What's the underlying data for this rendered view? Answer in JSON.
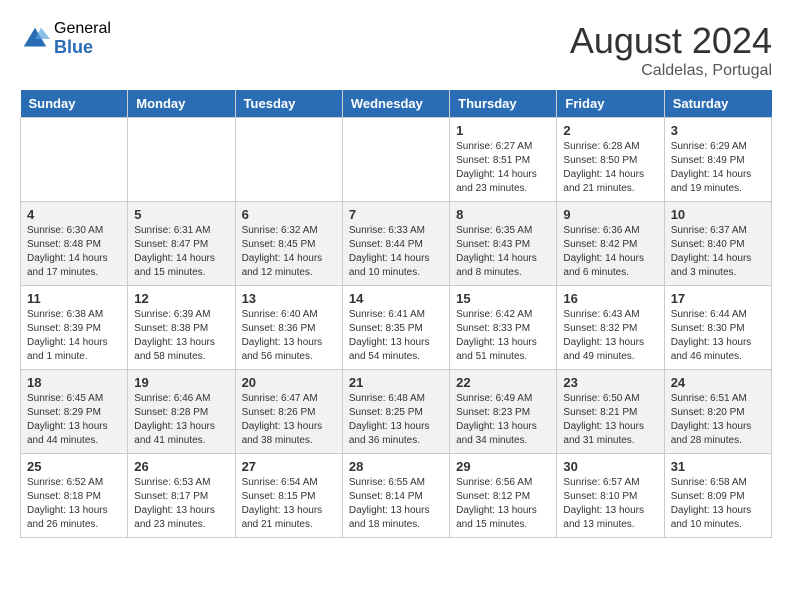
{
  "header": {
    "logo_general": "General",
    "logo_blue": "Blue",
    "month_year": "August 2024",
    "location": "Caldelas, Portugal"
  },
  "weekdays": [
    "Sunday",
    "Monday",
    "Tuesday",
    "Wednesday",
    "Thursday",
    "Friday",
    "Saturday"
  ],
  "weeks": [
    [
      {
        "day": "",
        "info": ""
      },
      {
        "day": "",
        "info": ""
      },
      {
        "day": "",
        "info": ""
      },
      {
        "day": "",
        "info": ""
      },
      {
        "day": "1",
        "info": "Sunrise: 6:27 AM\nSunset: 8:51 PM\nDaylight: 14 hours and 23 minutes."
      },
      {
        "day": "2",
        "info": "Sunrise: 6:28 AM\nSunset: 8:50 PM\nDaylight: 14 hours and 21 minutes."
      },
      {
        "day": "3",
        "info": "Sunrise: 6:29 AM\nSunset: 8:49 PM\nDaylight: 14 hours and 19 minutes."
      }
    ],
    [
      {
        "day": "4",
        "info": "Sunrise: 6:30 AM\nSunset: 8:48 PM\nDaylight: 14 hours and 17 minutes."
      },
      {
        "day": "5",
        "info": "Sunrise: 6:31 AM\nSunset: 8:47 PM\nDaylight: 14 hours and 15 minutes."
      },
      {
        "day": "6",
        "info": "Sunrise: 6:32 AM\nSunset: 8:45 PM\nDaylight: 14 hours and 12 minutes."
      },
      {
        "day": "7",
        "info": "Sunrise: 6:33 AM\nSunset: 8:44 PM\nDaylight: 14 hours and 10 minutes."
      },
      {
        "day": "8",
        "info": "Sunrise: 6:35 AM\nSunset: 8:43 PM\nDaylight: 14 hours and 8 minutes."
      },
      {
        "day": "9",
        "info": "Sunrise: 6:36 AM\nSunset: 8:42 PM\nDaylight: 14 hours and 6 minutes."
      },
      {
        "day": "10",
        "info": "Sunrise: 6:37 AM\nSunset: 8:40 PM\nDaylight: 14 hours and 3 minutes."
      }
    ],
    [
      {
        "day": "11",
        "info": "Sunrise: 6:38 AM\nSunset: 8:39 PM\nDaylight: 14 hours and 1 minute."
      },
      {
        "day": "12",
        "info": "Sunrise: 6:39 AM\nSunset: 8:38 PM\nDaylight: 13 hours and 58 minutes."
      },
      {
        "day": "13",
        "info": "Sunrise: 6:40 AM\nSunset: 8:36 PM\nDaylight: 13 hours and 56 minutes."
      },
      {
        "day": "14",
        "info": "Sunrise: 6:41 AM\nSunset: 8:35 PM\nDaylight: 13 hours and 54 minutes."
      },
      {
        "day": "15",
        "info": "Sunrise: 6:42 AM\nSunset: 8:33 PM\nDaylight: 13 hours and 51 minutes."
      },
      {
        "day": "16",
        "info": "Sunrise: 6:43 AM\nSunset: 8:32 PM\nDaylight: 13 hours and 49 minutes."
      },
      {
        "day": "17",
        "info": "Sunrise: 6:44 AM\nSunset: 8:30 PM\nDaylight: 13 hours and 46 minutes."
      }
    ],
    [
      {
        "day": "18",
        "info": "Sunrise: 6:45 AM\nSunset: 8:29 PM\nDaylight: 13 hours and 44 minutes."
      },
      {
        "day": "19",
        "info": "Sunrise: 6:46 AM\nSunset: 8:28 PM\nDaylight: 13 hours and 41 minutes."
      },
      {
        "day": "20",
        "info": "Sunrise: 6:47 AM\nSunset: 8:26 PM\nDaylight: 13 hours and 38 minutes."
      },
      {
        "day": "21",
        "info": "Sunrise: 6:48 AM\nSunset: 8:25 PM\nDaylight: 13 hours and 36 minutes."
      },
      {
        "day": "22",
        "info": "Sunrise: 6:49 AM\nSunset: 8:23 PM\nDaylight: 13 hours and 34 minutes."
      },
      {
        "day": "23",
        "info": "Sunrise: 6:50 AM\nSunset: 8:21 PM\nDaylight: 13 hours and 31 minutes."
      },
      {
        "day": "24",
        "info": "Sunrise: 6:51 AM\nSunset: 8:20 PM\nDaylight: 13 hours and 28 minutes."
      }
    ],
    [
      {
        "day": "25",
        "info": "Sunrise: 6:52 AM\nSunset: 8:18 PM\nDaylight: 13 hours and 26 minutes."
      },
      {
        "day": "26",
        "info": "Sunrise: 6:53 AM\nSunset: 8:17 PM\nDaylight: 13 hours and 23 minutes."
      },
      {
        "day": "27",
        "info": "Sunrise: 6:54 AM\nSunset: 8:15 PM\nDaylight: 13 hours and 21 minutes."
      },
      {
        "day": "28",
        "info": "Sunrise: 6:55 AM\nSunset: 8:14 PM\nDaylight: 13 hours and 18 minutes."
      },
      {
        "day": "29",
        "info": "Sunrise: 6:56 AM\nSunset: 8:12 PM\nDaylight: 13 hours and 15 minutes."
      },
      {
        "day": "30",
        "info": "Sunrise: 6:57 AM\nSunset: 8:10 PM\nDaylight: 13 hours and 13 minutes."
      },
      {
        "day": "31",
        "info": "Sunrise: 6:58 AM\nSunset: 8:09 PM\nDaylight: 13 hours and 10 minutes."
      }
    ]
  ]
}
